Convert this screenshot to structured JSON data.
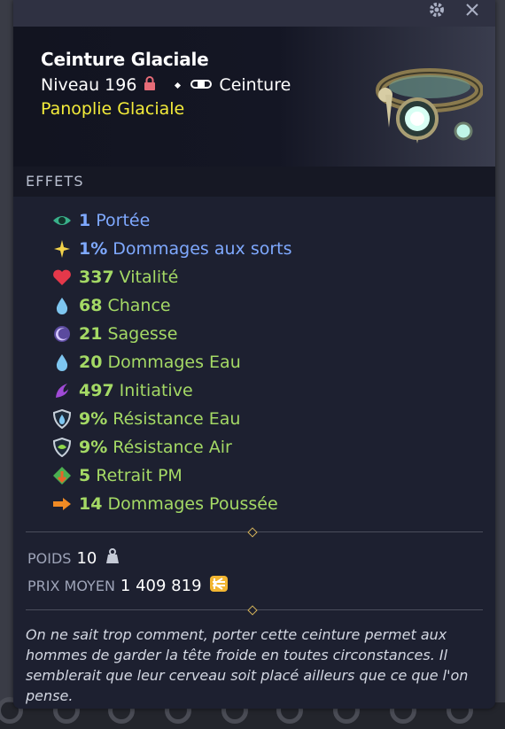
{
  "item": {
    "name": "Ceinture Glaciale",
    "level_label": "Niveau 196",
    "type": "Ceinture",
    "set_name": "Panoplie Glaciale"
  },
  "section_effects": "EFFETS",
  "effects": [
    {
      "value": "1",
      "label": "Portée",
      "color": "#7fa9ff",
      "icon": "eye-icon"
    },
    {
      "value": "1%",
      "label": "Dommages aux sorts",
      "color": "#7fa9ff",
      "icon": "sparkle-icon"
    },
    {
      "value": "337",
      "label": "Vitalité",
      "color": "#a4d965",
      "icon": "heart-icon"
    },
    {
      "value": "68",
      "label": "Chance",
      "color": "#a4d965",
      "icon": "water-drop-icon"
    },
    {
      "value": "21",
      "label": "Sagesse",
      "color": "#a4d965",
      "icon": "moon-icon"
    },
    {
      "value": "20",
      "label": "Dommages Eau",
      "color": "#a4d965",
      "icon": "water-drop-icon"
    },
    {
      "value": "497",
      "label": "Initiative",
      "color": "#a4d965",
      "icon": "initiative-icon"
    },
    {
      "value": "9%",
      "label": "Résistance Eau",
      "color": "#a4d965",
      "icon": "water-shield-icon"
    },
    {
      "value": "9%",
      "label": "Résistance Air",
      "color": "#a4d965",
      "icon": "air-shield-icon"
    },
    {
      "value": "5",
      "label": "Retrait PM",
      "color": "#a4d965",
      "icon": "mp-removal-icon"
    },
    {
      "value": "14",
      "label": "Dommages Poussée",
      "color": "#a4d965",
      "icon": "push-arrow-icon"
    }
  ],
  "meta": {
    "weight_label": "POIDS",
    "weight_value": "10",
    "price_label": "PRIX MOYEN",
    "price_value": "1 409 819"
  },
  "description": "On ne sait trop comment, porter cette ceinture permet aux hommes de garder la tête froide en toutes circonstances. Il semblerait que leur cerveau soit placé ailleurs que ce que l'on pense."
}
